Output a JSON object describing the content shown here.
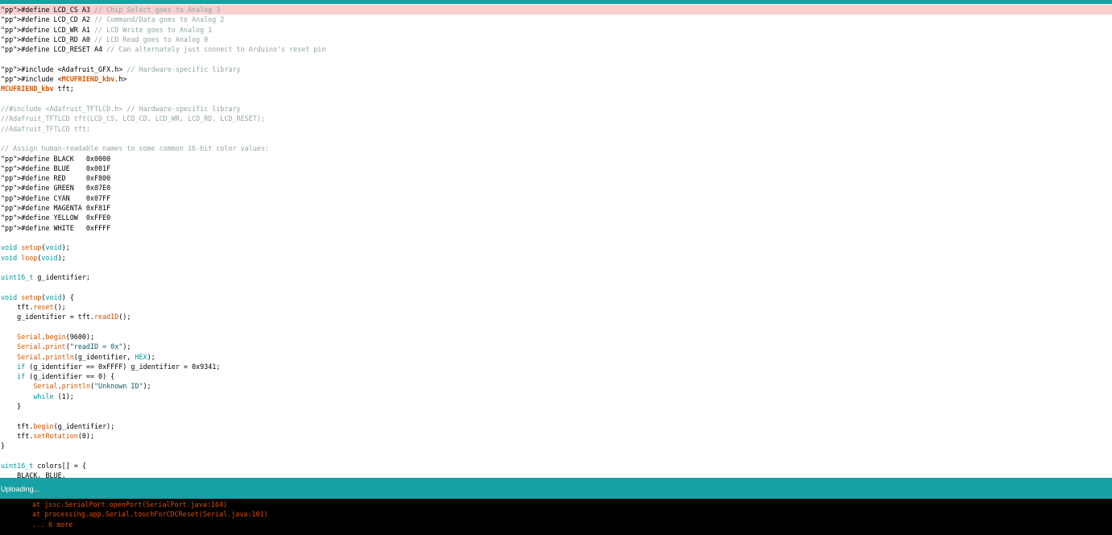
{
  "status": {
    "text": "Uploading..."
  },
  "colors": {
    "accent": "#17a1a5",
    "highlight": "#f9cfcf",
    "console_bg": "#000000",
    "console_text": "#e34c00"
  },
  "editor": {
    "lines": [
      {
        "t": "#define LCD_CS A3 // Chip Select goes to Analog 3",
        "highlight": true
      },
      {
        "t": "#define LCD_CD A2 // Command/Data goes to Analog 2"
      },
      {
        "t": "#define LCD_WR A1 // LCD Write goes to Analog 1"
      },
      {
        "t": "#define LCD_RD A0 // LCD Read goes to Analog 0"
      },
      {
        "t": "#define LCD_RESET A4 // Can alternately just connect to Arduino's reset pin"
      },
      {
        "t": ""
      },
      {
        "t": "#include <Adafruit_GFX.h> // Hardware-specific library"
      },
      {
        "t": "#include <MCUFRIEND_kbv.h>"
      },
      {
        "t": "MCUFRIEND_kbv tft;"
      },
      {
        "t": ""
      },
      {
        "t": "//#include <Adafruit_TFTLCD.h> // Hardware-specific library"
      },
      {
        "t": "//Adafruit_TFTLCD tft(LCD_CS, LCD_CD, LCD_WR, LCD_RD, LCD_RESET);"
      },
      {
        "t": "//Adafruit_TFTLCD tft;"
      },
      {
        "t": ""
      },
      {
        "t": "// Assign human-readable names to some common 16-bit color values:"
      },
      {
        "t": "#define BLACK   0x0000"
      },
      {
        "t": "#define BLUE    0x001F"
      },
      {
        "t": "#define RED     0xF800"
      },
      {
        "t": "#define GREEN   0x07E0"
      },
      {
        "t": "#define CYAN    0x07FF"
      },
      {
        "t": "#define MAGENTA 0xF81F"
      },
      {
        "t": "#define YELLOW  0xFFE0"
      },
      {
        "t": "#define WHITE   0xFFFF"
      },
      {
        "t": ""
      },
      {
        "t": "void setup(void);"
      },
      {
        "t": "void loop(void);"
      },
      {
        "t": ""
      },
      {
        "t": "uint16_t g_identifier;"
      },
      {
        "t": ""
      },
      {
        "t": "void setup(void) {"
      },
      {
        "t": "    tft.reset();"
      },
      {
        "t": "    g_identifier = tft.readID();"
      },
      {
        "t": ""
      },
      {
        "t": "    Serial.begin(9600);"
      },
      {
        "t": "    Serial.print(\"readID = 0x\");"
      },
      {
        "t": "    Serial.println(g_identifier, HEX);"
      },
      {
        "t": "    if (g_identifier == 0xFFFF) g_identifier = 0x9341;"
      },
      {
        "t": "    if (g_identifier == 0) {"
      },
      {
        "t": "        Serial.println(\"Unknown ID\");"
      },
      {
        "t": "        while (1);"
      },
      {
        "t": "    }"
      },
      {
        "t": ""
      },
      {
        "t": "    tft.begin(g_identifier);"
      },
      {
        "t": "    tft.setRotation(0);"
      },
      {
        "t": "}"
      },
      {
        "t": ""
      },
      {
        "t": "uint16_t colors[] = {"
      },
      {
        "t": "    BLACK, BLUE,"
      }
    ]
  },
  "console": {
    "lines": [
      "at jssc.SerialPort.openPort(SerialPort.java:164)",
      "at processing.app.Serial.touchForCDCReset(Serial.java:101)",
      "... 6 more"
    ]
  }
}
